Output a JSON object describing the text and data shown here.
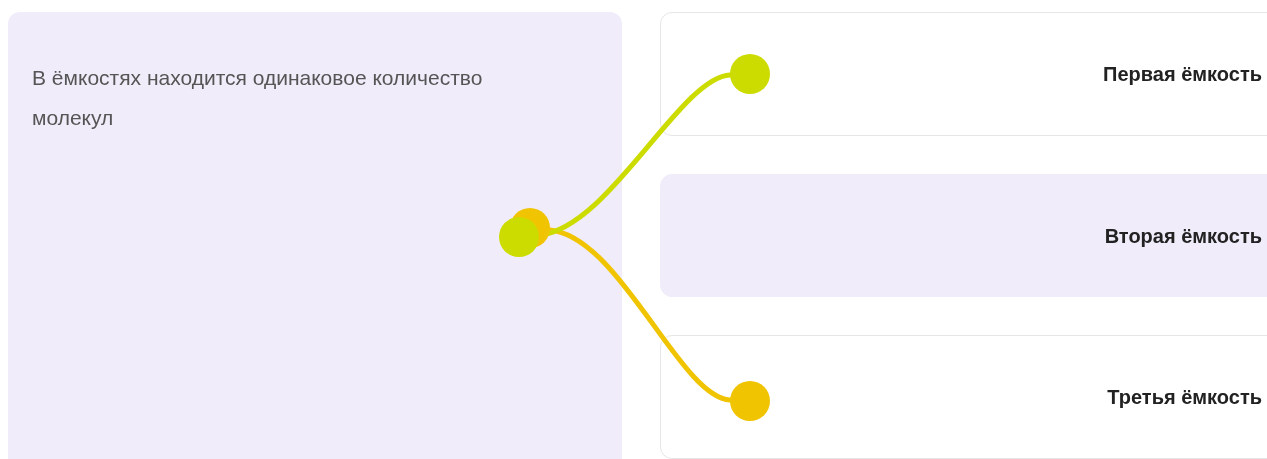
{
  "statement": {
    "text": "В ёмкостях находится одинаковое количество молекул"
  },
  "options": [
    {
      "label": "Первая ёмкость",
      "selected": false,
      "color": "#cddc00"
    },
    {
      "label": "Вторая ёмкость",
      "selected": true
    },
    {
      "label": "Третья ёмкость",
      "selected": false,
      "color": "#f0c400"
    }
  ]
}
